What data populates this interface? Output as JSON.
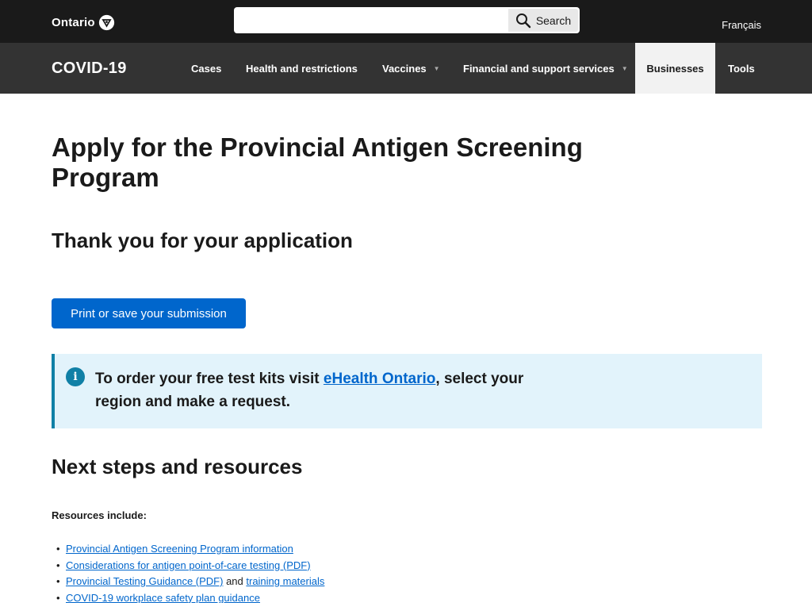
{
  "header": {
    "logo_text": "Ontario",
    "search_placeholder": "",
    "search_button_label": "Search",
    "language_link": "Français"
  },
  "nav": {
    "title": "COVID-19",
    "items": [
      {
        "label": "Cases",
        "has_dropdown": false,
        "active": false
      },
      {
        "label": "Health and restrictions",
        "has_dropdown": false,
        "active": false
      },
      {
        "label": "Vaccines",
        "has_dropdown": true,
        "active": false
      },
      {
        "label": "Financial and support services",
        "has_dropdown": true,
        "active": false
      },
      {
        "label": "Businesses",
        "has_dropdown": false,
        "active": true
      },
      {
        "label": "Tools",
        "has_dropdown": false,
        "active": false
      }
    ]
  },
  "main": {
    "title": "Apply for the Provincial Antigen Screening Program",
    "thanks_heading": "Thank you for your application",
    "print_button_label": "Print or save your submission",
    "callout": {
      "icon": "info-icon",
      "text_before": "To order your free test kits visit ",
      "link_text": "eHealth Ontario",
      "text_after": ", select your region and make a request."
    },
    "next_steps_heading": "Next steps and resources",
    "resources_label": "Resources include:",
    "resources": [
      {
        "link1": "Provincial Antigen Screening Program information",
        "joiner": "",
        "link2": ""
      },
      {
        "link1": "Considerations for antigen point-of-care testing (PDF)",
        "joiner": "",
        "link2": ""
      },
      {
        "link1": "Provincial Testing Guidance (PDF)",
        "joiner": " and ",
        "link2": "training materials"
      },
      {
        "link1": "COVID-19 workplace safety plan guidance",
        "joiner": "",
        "link2": ""
      }
    ]
  },
  "colors": {
    "topbar": "#1a1a1a",
    "navbar": "#333333",
    "primary_button": "#0066cc",
    "callout_background": "#e2f3fb",
    "callout_accent": "#1080a6",
    "link": "#0066cc"
  }
}
